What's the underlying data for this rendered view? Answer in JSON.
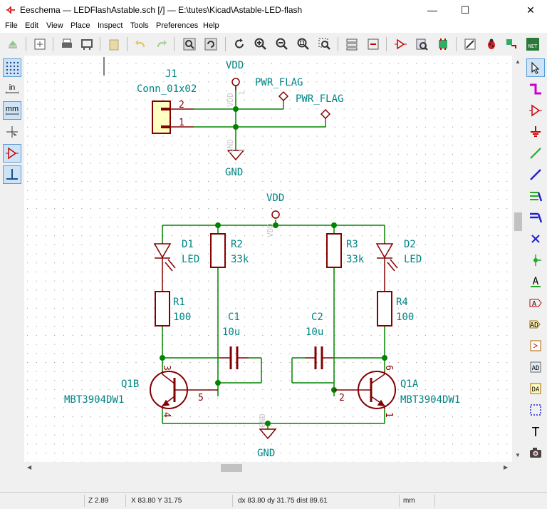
{
  "window": {
    "title": "Eeschema — LEDFlashAstable.sch [/] — E:\\tutes\\Kicad\\Astable-LED-flash",
    "minimize_glyph": "—",
    "maximize_glyph": "☐",
    "close_glyph": "✕"
  },
  "menu": [
    "File",
    "Edit",
    "View",
    "Place",
    "Inspect",
    "Tools",
    "Preferences",
    "Help"
  ],
  "left_toolbar": {
    "inch_label": "in",
    "mm_label": "mm"
  },
  "schematic": {
    "j1_ref": "J1",
    "j1_value": "Conn_01x02",
    "j1_pin2": "2",
    "j1_pin1": "1",
    "top_vdd": "VDD",
    "top_gnd": "GND",
    "pwr_flag_1": "PWR_FLAG",
    "pwr_flag_2": "PWR_FLAG",
    "vdd_sym_text": "VDD",
    "gnd_sym_text": "GND",
    "pin_one_a": "1",
    "pin_one_b": "1",
    "vdd2": "VDD",
    "vdd2_sym_text": "VDD",
    "gnd2": "GND",
    "gnd2_sym_text": "GND",
    "d1_ref": "D1",
    "d1_value": "LED",
    "d2_ref": "D2",
    "d2_value": "LED",
    "r1_ref": "R1",
    "r1_value": "100",
    "r2_ref": "R2",
    "r2_value": "33k",
    "r3_ref": "R3",
    "r3_value": "33k",
    "r4_ref": "R4",
    "r4_value": "100",
    "c1_ref": "C1",
    "c1_value": "10u",
    "c2_ref": "C2",
    "c2_value": "10u",
    "q1b_ref": "Q1B",
    "q1b_value": "MBT3904DW1",
    "q1b_pin3": "3",
    "q1b_pin5": "5",
    "q1b_pin4": "4",
    "q1a_ref": "Q1A",
    "q1a_value": "MBT3904DW1",
    "q1a_pin6": "6",
    "q1a_pin2": "2",
    "q1a_pin1": "1"
  },
  "status": {
    "zoom": "Z 2.89",
    "xy": "X 83.80  Y 31.75",
    "delta": "dx 83.80  dy 31.75  dist 89.61",
    "units": "mm"
  },
  "colors": {
    "wire": "#008400",
    "component": "#840000",
    "text_teal": "#008484",
    "junction": "#008400",
    "grid": "#8c8c8c",
    "connector_fill": "#ffffc2"
  }
}
